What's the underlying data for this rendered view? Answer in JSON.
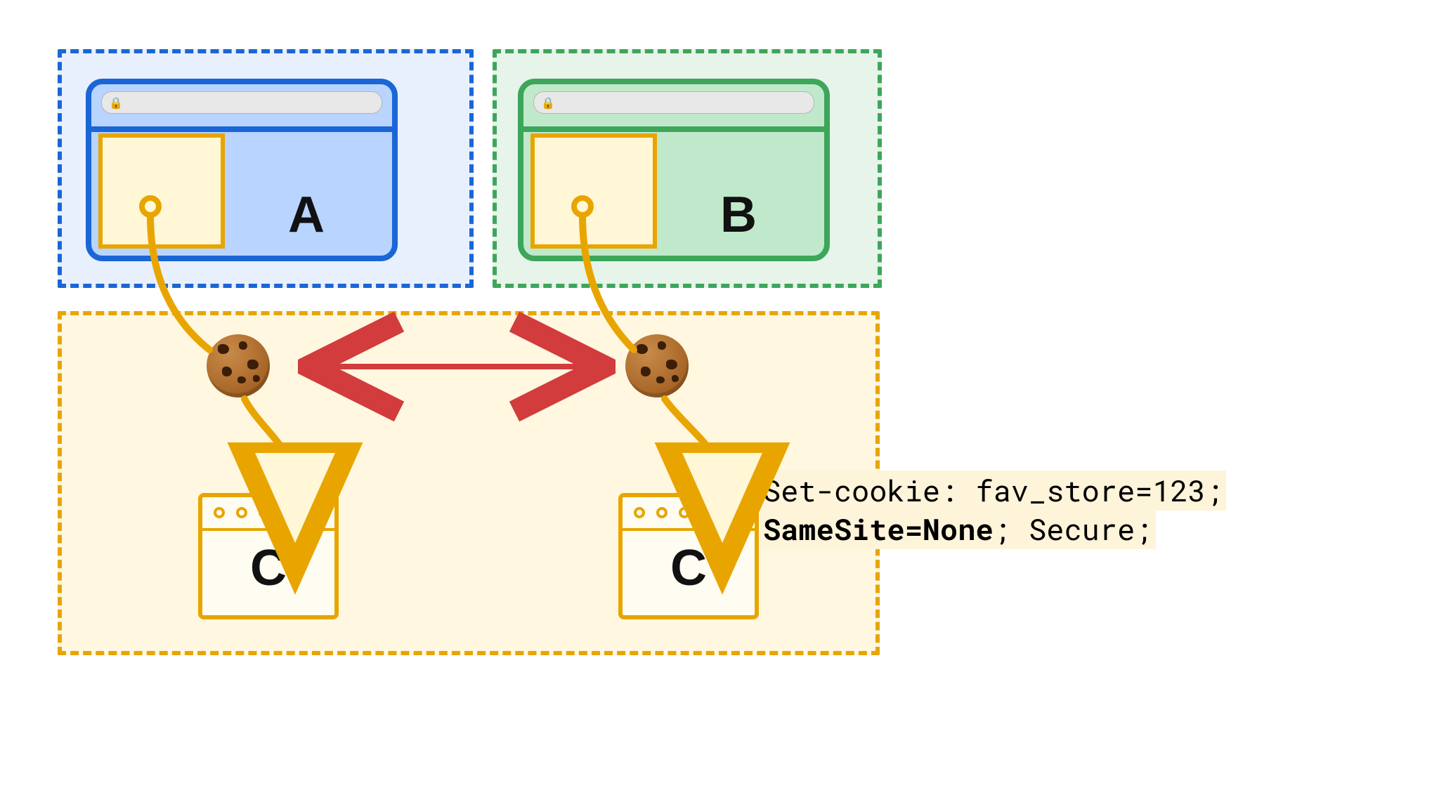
{
  "labels": {
    "site_a": "A",
    "site_b": "B",
    "server_c_left": "C",
    "server_c_right": "C"
  },
  "colors": {
    "blue": "#1A66D6",
    "green": "#3DA65A",
    "orange": "#E8A500",
    "red": "#D23C3C"
  },
  "code": {
    "line1": "Set-cookie: fav_store=123;",
    "line2_strong": "SameSite=None",
    "line2_tail": "; Secure;"
  },
  "cookie_value": "fav_store=123",
  "cookie_attributes": [
    "SameSite=None",
    "Secure"
  ]
}
